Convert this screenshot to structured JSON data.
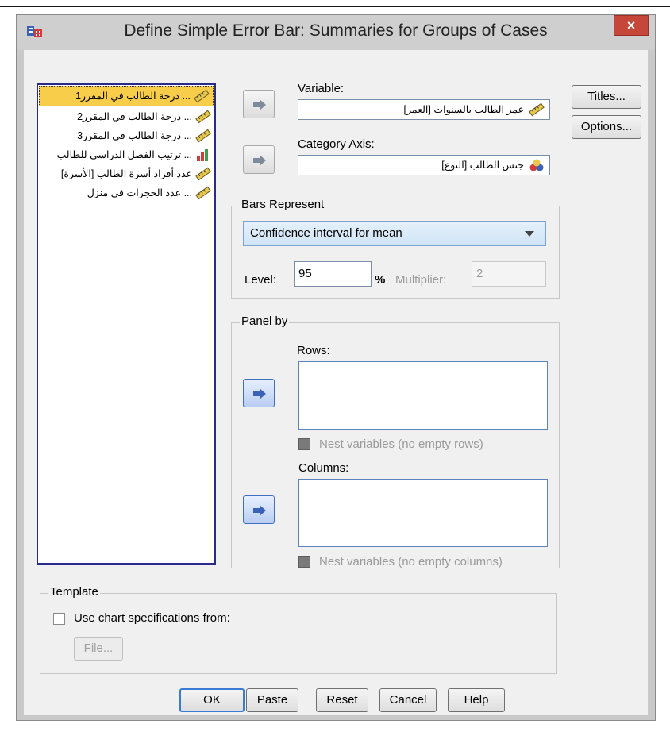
{
  "window": {
    "title": "Define Simple Error Bar: Summaries for Groups of Cases",
    "close_label": "×"
  },
  "source_variables": [
    {
      "label": "درجة الطالب في المقرر1 ...",
      "icon": "scale-ruler-icon",
      "selected": true
    },
    {
      "label": "درجة الطالب في المقرر2 ...",
      "icon": "scale-ruler-icon",
      "selected": false
    },
    {
      "label": "درجة الطالب في المقرر3 ...",
      "icon": "scale-ruler-icon",
      "selected": false
    },
    {
      "label": "ترتيب الفصل الدراسي للطالب ...",
      "icon": "ordinal-bars-icon",
      "selected": false
    },
    {
      "label": "عدد أفراد أسرة الطالب [الأسرة]",
      "icon": "scale-ruler-icon",
      "selected": false
    },
    {
      "label": "عدد الحجرات في منزل ...",
      "icon": "scale-ruler-icon",
      "selected": false
    }
  ],
  "variable": {
    "label": "Variable:",
    "value": "عمر الطالب بالسنوات [العمر]",
    "icon": "scale-ruler-icon"
  },
  "category_axis": {
    "label": "Category Axis:",
    "value": "جنس الطالب [النوع]",
    "icon": "nominal-icon"
  },
  "bars_represent": {
    "title": "Bars Represent",
    "selected": "Confidence interval for mean",
    "level_label": "Level:",
    "level_value": "95",
    "percent_label": "%",
    "multiplier_label": "Multiplier:",
    "multiplier_value": "2"
  },
  "panel_by": {
    "title": "Panel by",
    "rows_label": "Rows:",
    "nest_rows_label": "Nest variables (no empty rows)",
    "columns_label": "Columns:",
    "nest_columns_label": "Nest variables (no empty columns)"
  },
  "template": {
    "title": "Template",
    "use_spec_label": "Use chart specifications from:",
    "file_label": "File..."
  },
  "side_buttons": {
    "titles": "Titles...",
    "options": "Options..."
  },
  "footer": {
    "ok": "OK",
    "paste": "Paste",
    "reset": "Reset",
    "cancel": "Cancel",
    "help": "Help"
  },
  "colors": {
    "selection": "#f7cd4a",
    "close_button": "#c7463a",
    "list_border": "#2a2a8a",
    "default_button_border": "#3a7bd5"
  }
}
